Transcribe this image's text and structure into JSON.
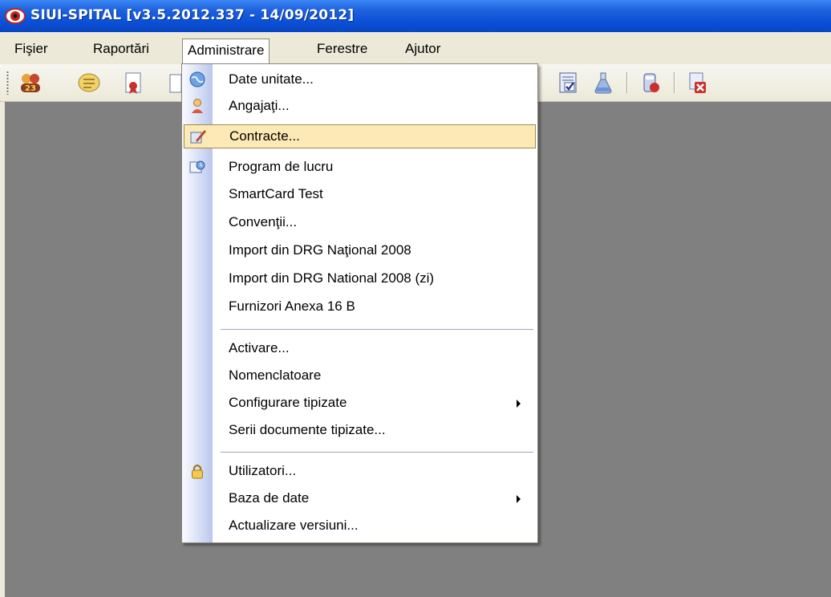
{
  "window": {
    "title": "SIUI-SPITAL [v3.5.2012.337 - 14/09/2012]"
  },
  "menubar": {
    "items": [
      {
        "label": "Fişier"
      },
      {
        "label": "Raportări"
      },
      {
        "label": "Administrare"
      },
      {
        "label": "Ferestre"
      },
      {
        "label": "Ajutor"
      }
    ],
    "open_item": "Administrare"
  },
  "toolbar": {
    "icons": [
      "users-icon",
      "notes-icon",
      "document-ribbon-icon",
      "checklist-icon",
      "flask-icon",
      "drug-icon",
      "delete-document-icon"
    ]
  },
  "dropdown": {
    "items": [
      {
        "label": "Date unitate...",
        "icon": "globe-icon"
      },
      {
        "label": "Angajaţi...",
        "icon": "person-icon"
      },
      {
        "label": "Contracte...",
        "icon": "pen-document-icon",
        "highlighted": true
      },
      {
        "label": "Program de lucru",
        "icon": "schedule-icon"
      },
      {
        "label": "SmartCard Test"
      },
      {
        "label": "Convenţii..."
      },
      {
        "label": "Import din DRG Naţional 2008"
      },
      {
        "label": "Import din DRG National 2008 (zi)"
      },
      {
        "label": "Furnizori Anexa 16 B"
      },
      {
        "label": "Activare..."
      },
      {
        "label": "Nomenclatoare"
      },
      {
        "label": "Configurare tipizate",
        "submenu": true
      },
      {
        "label": "Serii documente tipizate..."
      },
      {
        "label": "Utilizatori...",
        "icon": "lock-icon"
      },
      {
        "label": "Baza de date",
        "submenu": true
      },
      {
        "label": "Actualizare versiuni..."
      }
    ]
  },
  "colors": {
    "titlebar": "#0a4fd6",
    "menubar": "#ece9d8",
    "workspace": "#808080",
    "highlight": "#fbe9b6"
  }
}
